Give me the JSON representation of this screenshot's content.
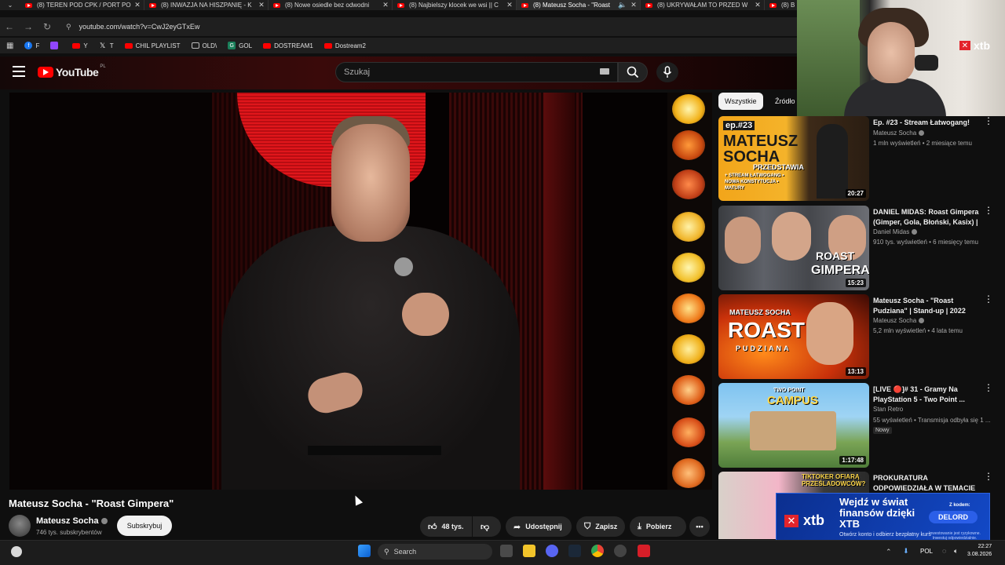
{
  "browser": {
    "tabs": [
      {
        "title": "(8) TEREN POD CPK / PORT PO",
        "active": false
      },
      {
        "title": "(8) INWAZJA NA HISZPANIĘ - K",
        "active": false
      },
      {
        "title": "(8) Nowe osiedle bez odwodni",
        "active": false
      },
      {
        "title": "(8) Najbielszy klocek we wsi || C",
        "active": false
      },
      {
        "title": "(8) Mateusz Socha - \"Roast",
        "active": true
      },
      {
        "title": "(8) UKRYWAŁAM TO PRZED W",
        "active": false
      },
      {
        "title": "(8) B",
        "active": false
      }
    ],
    "url": "youtube.com/watch?v=CwJ2eyGTxEw",
    "bookmarks": [
      {
        "label": "F",
        "color": "#1877f2"
      },
      {
        "label": "",
        "color": "#9146ff"
      },
      {
        "label": "Y",
        "color": "#ff0000"
      },
      {
        "label": "T",
        "color": "#000000"
      },
      {
        "label": "CHIL PLAYLIST",
        "color": "#ff0000"
      },
      {
        "label": "OLD\\",
        "color": "#777777"
      },
      {
        "label": "GOL",
        "color": "#1a7f5a"
      },
      {
        "label": "DOSTREAM1",
        "color": "#ff0000"
      },
      {
        "label": "Dostream2",
        "color": "#ff0000"
      }
    ]
  },
  "youtube": {
    "logo": "YouTube",
    "region": "PL",
    "search_placeholder": "Szukaj",
    "video": {
      "title": "Mateusz Socha - \"Roast Gimpera\"",
      "channel": "Mateusz Socha",
      "subscribers": "746 tys. subskrybentów",
      "subscribe_label": "Subskrybuj",
      "likes": "48 tys.",
      "share_label": "Udostępnij",
      "save_label": "Zapisz",
      "download_label": "Pobierz"
    },
    "chips": [
      "Wszystkie",
      "Źródło"
    ],
    "recommendations": [
      {
        "title": "Ep. #23 - Stream Łatwogang!",
        "channel": "Mateusz Socha",
        "meta": "1 mln wyświetleń • 2 miesiące temu",
        "duration": "20:27",
        "verified": true,
        "badge": ""
      },
      {
        "title": "DANIEL MIDAS: Roast Gimpera (Gimper, Gola, Błoński, Kasix) | ...",
        "channel": "Daniel Midas",
        "meta": "910 tys. wyświetleń • 6 miesięcy temu",
        "duration": "15:23",
        "verified": true,
        "badge": ""
      },
      {
        "title": "Mateusz Socha - \"Roast Pudziana\" | Stand-up | 2022",
        "channel": "Mateusz Socha",
        "meta": "5,2 mln wyświetleń • 4 lata temu",
        "duration": "13:13",
        "verified": true,
        "badge": ""
      },
      {
        "title": "[LIVE 🔴]# 31 - Gramy Na PlayStation 5 - Two Point ...",
        "channel": "Stan Retro",
        "meta": "55 wyświetleń • Transmisja odbyła się 1 ...",
        "duration": "1:17:48",
        "verified": false,
        "badge": "Nowy"
      },
      {
        "title": "PROKURATURA ODPOWIEDZIAŁA W TEMACIE ...",
        "channel": "",
        "meta": "",
        "duration": "",
        "verified": false,
        "badge": ""
      }
    ],
    "thumb_texts": {
      "t1_ep": "ep.#23",
      "t1_name": "MATEUSZ SOCHA",
      "t1_sub": "PRZEDSTAWIA",
      "t1_list": "+ STREAM ŁATWOGANG • NOWA KONSTYTUCJA • MATURY",
      "t2_a": "ROAST",
      "t2_b": "GIMPERA",
      "t3_top": "MATEUSZ SOCHA",
      "t3_big": "ROAST",
      "t3_sub": "PUDZIANA",
      "t4_a": "TWO POINT",
      "t4_b": "CAMPUS",
      "t5": "TIKTOKER OFIARĄ PRZEŚLADOWCÓW?"
    }
  },
  "webcam_overlay": {
    "brand": "xtb"
  },
  "ad": {
    "brand": "xtb",
    "headline": "Wejdź w świat finansów dzięki XTB",
    "subline": "Otwórz konto i odbierz bezpłatny kurs",
    "code_label": "Z kodem:",
    "code": "DELORD",
    "fine": "Inwestowanie jest ryzykowne. Inwestuj odpowiedzialnie."
  },
  "taskbar": {
    "search_placeholder": "Search",
    "lang": "POL",
    "time": "22:27",
    "date": "3.08.2026"
  },
  "colors": {
    "accent": "#ff0000",
    "xtb_red": "#e3242b",
    "ad_blue": "#1349c7"
  }
}
